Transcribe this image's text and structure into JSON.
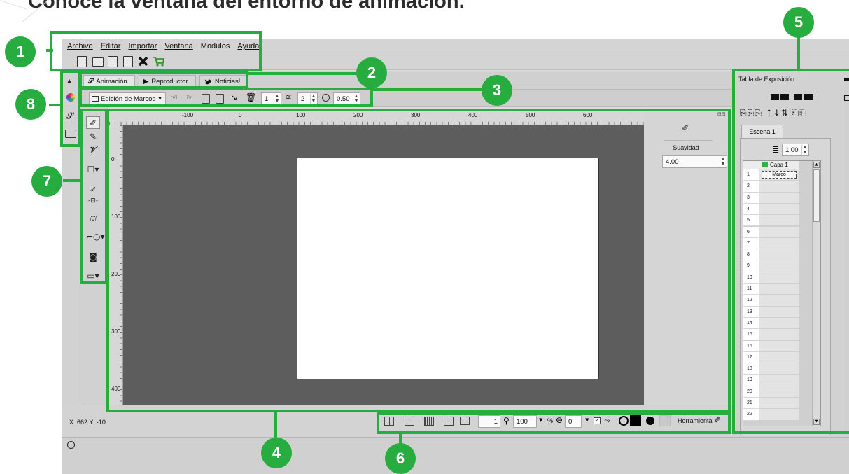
{
  "headline": "Conoce la ventana del entorno de animación.",
  "menu": [
    "Archivo",
    "Editar",
    "Importar",
    "Ventana",
    "Módulos",
    "Ayuda"
  ],
  "tabs": {
    "animacion": "Animación",
    "reproductor": "Reproductor",
    "noticias": "Noticias!"
  },
  "controls": {
    "mode": "Edición de Marcos",
    "spin1": "1",
    "spin2": "2",
    "spin3": "0.50"
  },
  "ruler_h": [
    "-100",
    "0",
    "100",
    "200",
    "300",
    "400",
    "500",
    "600"
  ],
  "ruler_v": [
    "0",
    "100",
    "200",
    "300",
    "400"
  ],
  "props": {
    "label": "Suavidad",
    "value": "4.00"
  },
  "status": {
    "coords": "X: 662 Y: -10",
    "frame": "1",
    "zoom": "100",
    "zoom_unit": "%",
    "rotation": "0",
    "tool_label": "Herramienta"
  },
  "exposure": {
    "title": "Tabla de Exposición",
    "scene": "Escena 1",
    "opacity": "1.00",
    "layer": "Capa 1",
    "first_frame": "Marco",
    "rows": [
      "1",
      "2",
      "3",
      "4",
      "5",
      "6",
      "7",
      "8",
      "9",
      "10",
      "11",
      "12",
      "13",
      "14",
      "15",
      "16",
      "17",
      "18",
      "19",
      "20",
      "21",
      "22"
    ]
  },
  "badges": [
    "1",
    "2",
    "3",
    "4",
    "5",
    "6",
    "7",
    "8"
  ],
  "colors": {
    "annotation": "#27ad3f",
    "workspace": "#5d5d5d",
    "panel": "#d2d2d2",
    "layer_swatch": "#2eb34a"
  }
}
